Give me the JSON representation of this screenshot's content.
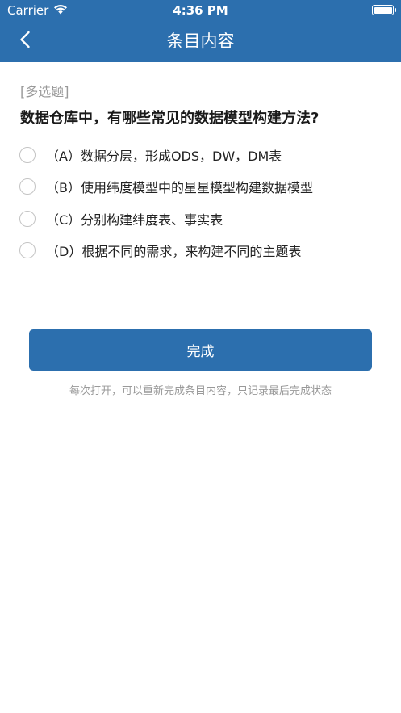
{
  "status_bar": {
    "carrier": "Carrier",
    "time": "4:36 PM",
    "battery_icon": "battery-full-icon",
    "wifi_icon": "wifi-icon"
  },
  "nav": {
    "title": "条目内容",
    "back_icon": "chevron-left-icon",
    "background_color": "#2c6fae"
  },
  "question": {
    "type_label": "[多选题]",
    "text": "数据仓库中，有哪些常见的数据模型构建方法?",
    "options": [
      {
        "label": "（A）数据分层，形成ODS，DW，DM表",
        "selected": false
      },
      {
        "label": "（B）使用纬度模型中的星星模型构建数据模型",
        "selected": false
      },
      {
        "label": "（C）分别构建纬度表、事实表",
        "selected": false
      },
      {
        "label": "（D）根据不同的需求，来构建不同的主题表",
        "selected": false
      }
    ]
  },
  "footer": {
    "done_label": "完成",
    "hint": "每次打开，可以重新完成条目内容，只记录最后完成状态",
    "accent_color": "#2c6fae"
  }
}
